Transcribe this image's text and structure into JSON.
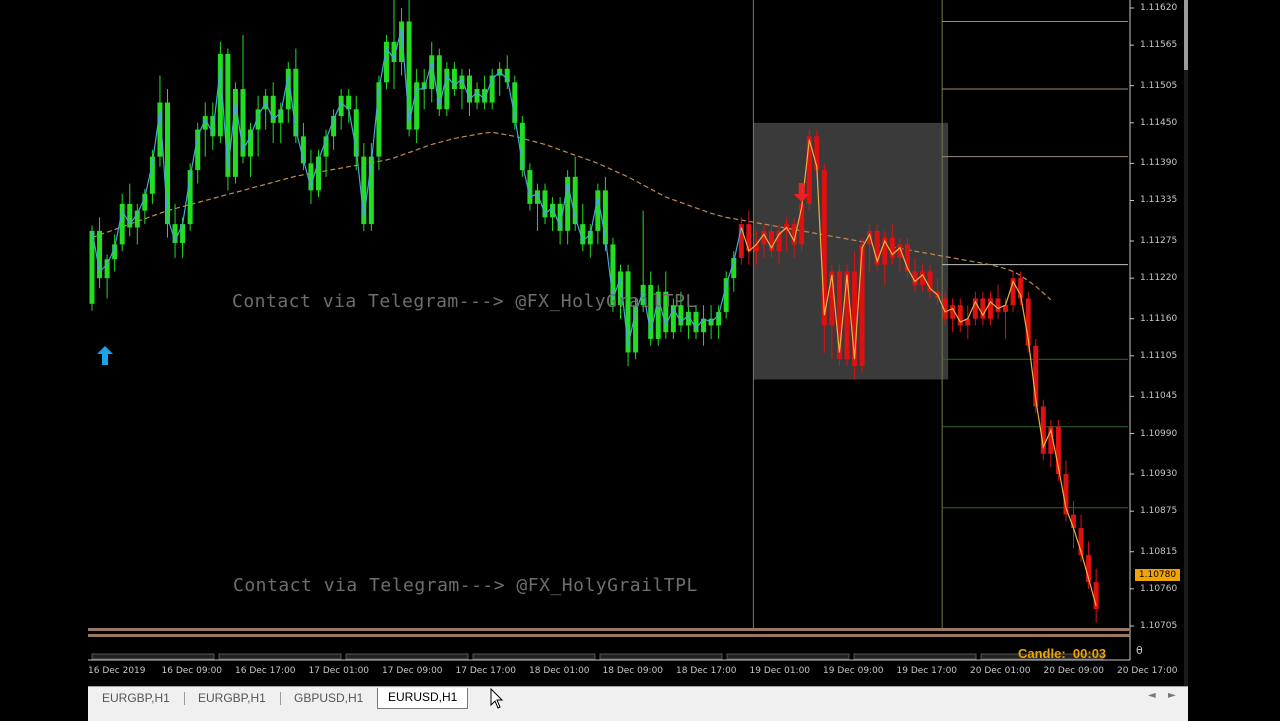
{
  "watermarks": [
    "Contact via Telegram---> @FX_HolyGrailTPL",
    "Contact via Telegram---> @FX_HolyGrailTPL"
  ],
  "price_axis": [
    "1.11620",
    "1.11565",
    "1.11505",
    "1.11450",
    "1.11390",
    "1.11335",
    "1.11275",
    "1.11220",
    "1.11160",
    "1.11105",
    "1.11045",
    "1.10990",
    "1.10930",
    "1.10875",
    "1.10815",
    "1.10760",
    "1.10705"
  ],
  "current_price": "1.10780",
  "time_axis": [
    "16 Dec 2019",
    "16 Dec 09:00",
    "16 Dec 17:00",
    "17 Dec 01:00",
    "17 Dec 09:00",
    "17 Dec 17:00",
    "18 Dec 01:00",
    "18 Dec 09:00",
    "18 Dec 17:00",
    "19 Dec 01:00",
    "19 Dec 09:00",
    "19 Dec 17:00",
    "20 Dec 01:00",
    "20 Dec 09:00",
    "20 Dec 17:00"
  ],
  "candle_timer": {
    "label": "Candle:",
    "value": "00:03"
  },
  "timer_marker": "θ",
  "tabs": [
    {
      "label": "EURGBP,H1",
      "active": false
    },
    {
      "label": "EURGBP,H1",
      "active": false
    },
    {
      "label": "GBPUSD,H1",
      "active": false
    },
    {
      "label": "EURUSD,H1",
      "active": true
    }
  ],
  "tab_scroll": {
    "left": "◄",
    "right": "►"
  },
  "colors": {
    "bull": "#22dd22",
    "bear": "#dd1111",
    "ma_fast_bull": "#4aa3df",
    "ma_fast_bear": "#f0b040",
    "ma_slow": "#c08a50",
    "buy_arrow": "#1aa3e8",
    "sell_arrow": "#ee2222",
    "zone": "#3a3a3a"
  },
  "icons": {
    "buy": "arrow-up-icon",
    "sell": "arrow-down-icon",
    "cursor": "mouse-cursor-icon"
  },
  "chart_data": {
    "type": "candlestick",
    "symbol": "EURUSD",
    "timeframe": "H1",
    "ylim": [
      1.10705,
      1.1162
    ],
    "x_range": [
      "16 Dec 2019 00:00",
      "20 Dec 2019 19:00"
    ],
    "candles": [
      [
        1.11182,
        1.11298,
        1.11172,
        1.1129
      ],
      [
        1.1129,
        1.1131,
        1.11205,
        1.1122
      ],
      [
        1.1122,
        1.11255,
        1.1119,
        1.11248
      ],
      [
        1.11248,
        1.11285,
        1.1123,
        1.1127
      ],
      [
        1.1127,
        1.11345,
        1.1126,
        1.1133
      ],
      [
        1.1133,
        1.1136,
        1.11282,
        1.11295
      ],
      [
        1.11295,
        1.1133,
        1.1127,
        1.1132
      ],
      [
        1.1132,
        1.11352,
        1.113,
        1.11345
      ],
      [
        1.11345,
        1.1141,
        1.1133,
        1.114
      ],
      [
        1.114,
        1.1152,
        1.11385,
        1.1148
      ],
      [
        1.1148,
        1.115,
        1.1128,
        1.113
      ],
      [
        1.113,
        1.1133,
        1.1125,
        1.11272
      ],
      [
        1.11272,
        1.1131,
        1.1125,
        1.113
      ],
      [
        1.113,
        1.1139,
        1.1129,
        1.1138
      ],
      [
        1.1138,
        1.1145,
        1.1136,
        1.1144
      ],
      [
        1.1144,
        1.1148,
        1.114,
        1.1146
      ],
      [
        1.1146,
        1.1148,
        1.1141,
        1.1143
      ],
      [
        1.1143,
        1.1157,
        1.1142,
        1.11552
      ],
      [
        1.11552,
        1.1156,
        1.1135,
        1.1137
      ],
      [
        1.1137,
        1.1151,
        1.1136,
        1.115
      ],
      [
        1.115,
        1.1158,
        1.1139,
        1.114
      ],
      [
        1.114,
        1.1145,
        1.1137,
        1.1144
      ],
      [
        1.1144,
        1.1149,
        1.114,
        1.1147
      ],
      [
        1.1147,
        1.115,
        1.1144,
        1.1149
      ],
      [
        1.1149,
        1.1151,
        1.1142,
        1.1145
      ],
      [
        1.1145,
        1.1148,
        1.1142,
        1.1147
      ],
      [
        1.1147,
        1.1154,
        1.1145,
        1.1153
      ],
      [
        1.1153,
        1.1156,
        1.1142,
        1.1143
      ],
      [
        1.1143,
        1.1145,
        1.1138,
        1.1139
      ],
      [
        1.1139,
        1.1141,
        1.1133,
        1.1135
      ],
      [
        1.1135,
        1.1141,
        1.1134,
        1.114
      ],
      [
        1.114,
        1.1144,
        1.1137,
        1.1143
      ],
      [
        1.1143,
        1.1147,
        1.1141,
        1.1146
      ],
      [
        1.1146,
        1.115,
        1.1144,
        1.1149
      ],
      [
        1.1149,
        1.115,
        1.1145,
        1.1147
      ],
      [
        1.1147,
        1.1149,
        1.1138,
        1.114
      ],
      [
        1.114,
        1.1142,
        1.1129,
        1.113
      ],
      [
        1.113,
        1.1142,
        1.1129,
        1.114
      ],
      [
        1.114,
        1.1152,
        1.1138,
        1.1151
      ],
      [
        1.1151,
        1.1158,
        1.115,
        1.1157
      ],
      [
        1.1157,
        1.1167,
        1.115,
        1.1154
      ],
      [
        1.1154,
        1.1162,
        1.1152,
        1.116
      ],
      [
        1.116,
        1.1164,
        1.1143,
        1.1144
      ],
      [
        1.1144,
        1.1153,
        1.1142,
        1.1151
      ],
      [
        1.1151,
        1.1153,
        1.1147,
        1.115
      ],
      [
        1.115,
        1.1157,
        1.1148,
        1.1155
      ],
      [
        1.1155,
        1.1156,
        1.1146,
        1.1147
      ],
      [
        1.1147,
        1.1154,
        1.1146,
        1.1153
      ],
      [
        1.1153,
        1.1154,
        1.1149,
        1.115
      ],
      [
        1.115,
        1.1153,
        1.1147,
        1.1152
      ],
      [
        1.1152,
        1.1153,
        1.1146,
        1.1148
      ],
      [
        1.1148,
        1.1151,
        1.1147,
        1.115
      ],
      [
        1.115,
        1.1152,
        1.1147,
        1.1148
      ],
      [
        1.1148,
        1.1153,
        1.1147,
        1.1152
      ],
      [
        1.1152,
        1.1154,
        1.1149,
        1.1153
      ],
      [
        1.1153,
        1.1155,
        1.115,
        1.1151
      ],
      [
        1.1151,
        1.1152,
        1.1144,
        1.1145
      ],
      [
        1.1145,
        1.1146,
        1.1137,
        1.1138
      ],
      [
        1.1138,
        1.1139,
        1.1132,
        1.1133
      ],
      [
        1.1133,
        1.1136,
        1.1129,
        1.1135
      ],
      [
        1.1135,
        1.1136,
        1.113,
        1.1131
      ],
      [
        1.1131,
        1.1134,
        1.1129,
        1.1133
      ],
      [
        1.1133,
        1.1134,
        1.1127,
        1.1129
      ],
      [
        1.1129,
        1.1138,
        1.1127,
        1.1137
      ],
      [
        1.1137,
        1.114,
        1.1129,
        1.113
      ],
      [
        1.113,
        1.1133,
        1.1126,
        1.1127
      ],
      [
        1.1127,
        1.113,
        1.1125,
        1.1129
      ],
      [
        1.1129,
        1.1136,
        1.1127,
        1.1135
      ],
      [
        1.1135,
        1.1137,
        1.1126,
        1.1127
      ],
      [
        1.1127,
        1.1128,
        1.1117,
        1.1118
      ],
      [
        1.1118,
        1.1124,
        1.1116,
        1.1123
      ],
      [
        1.1123,
        1.1124,
        1.1109,
        1.1111
      ],
      [
        1.1111,
        1.1119,
        1.111,
        1.1118
      ],
      [
        1.1118,
        1.1132,
        1.1117,
        1.1121
      ],
      [
        1.1121,
        1.1123,
        1.1112,
        1.1113
      ],
      [
        1.1113,
        1.1121,
        1.1112,
        1.112
      ],
      [
        1.112,
        1.1123,
        1.1113,
        1.1114
      ],
      [
        1.1114,
        1.1119,
        1.1113,
        1.1118
      ],
      [
        1.1118,
        1.112,
        1.1114,
        1.1115
      ],
      [
        1.1115,
        1.1119,
        1.1113,
        1.1117
      ],
      [
        1.1117,
        1.1118,
        1.1113,
        1.1114
      ],
      [
        1.1114,
        1.1118,
        1.1112,
        1.1116
      ],
      [
        1.1116,
        1.1118,
        1.1113,
        1.1115
      ],
      [
        1.1115,
        1.1118,
        1.1113,
        1.1117
      ],
      [
        1.1117,
        1.1123,
        1.1116,
        1.1122
      ],
      [
        1.1122,
        1.1126,
        1.112,
        1.1125
      ],
      [
        1.1125,
        1.1131,
        1.1124,
        1.113
      ],
      [
        1.113,
        1.1132,
        1.1124,
        1.1126
      ],
      [
        1.1126,
        1.1129,
        1.1124,
        1.1127
      ],
      [
        1.1127,
        1.113,
        1.1125,
        1.1129
      ],
      [
        1.1129,
        1.113,
        1.1125,
        1.1126
      ],
      [
        1.1126,
        1.113,
        1.1124,
        1.1129
      ],
      [
        1.1129,
        1.1131,
        1.1126,
        1.113
      ],
      [
        1.113,
        1.1131,
        1.1125,
        1.1127
      ],
      [
        1.1127,
        1.1134,
        1.1126,
        1.1133
      ],
      [
        1.1133,
        1.1144,
        1.1132,
        1.1143
      ],
      [
        1.1143,
        1.1144,
        1.1137,
        1.1138
      ],
      [
        1.1138,
        1.1139,
        1.1111,
        1.1115
      ],
      [
        1.1115,
        1.1124,
        1.111,
        1.1123
      ],
      [
        1.1123,
        1.1124,
        1.1109,
        1.111
      ],
      [
        1.111,
        1.1124,
        1.1109,
        1.1123
      ],
      [
        1.1123,
        1.1126,
        1.1107,
        1.1109
      ],
      [
        1.1109,
        1.1128,
        1.1108,
        1.1127
      ],
      [
        1.1127,
        1.113,
        1.1123,
        1.1129
      ],
      [
        1.1129,
        1.113,
        1.1123,
        1.1124
      ],
      [
        1.1124,
        1.1129,
        1.1121,
        1.1128
      ],
      [
        1.1128,
        1.113,
        1.1124,
        1.1125
      ],
      [
        1.1125,
        1.1128,
        1.1123,
        1.1127
      ],
      [
        1.1127,
        1.1128,
        1.1122,
        1.1123
      ],
      [
        1.1123,
        1.1125,
        1.112,
        1.1121
      ],
      [
        1.1121,
        1.1124,
        1.112,
        1.1123
      ],
      [
        1.1123,
        1.1124,
        1.1119,
        1.112
      ],
      [
        1.112,
        1.1122,
        1.1118,
        1.1119
      ],
      [
        1.1119,
        1.112,
        1.1115,
        1.1116
      ],
      [
        1.1116,
        1.1119,
        1.1114,
        1.1118
      ],
      [
        1.1118,
        1.1119,
        1.1114,
        1.1115
      ],
      [
        1.1115,
        1.1118,
        1.1113,
        1.1116
      ],
      [
        1.1116,
        1.112,
        1.1115,
        1.1119
      ],
      [
        1.1119,
        1.112,
        1.1115,
        1.1116
      ],
      [
        1.1116,
        1.112,
        1.1115,
        1.1119
      ],
      [
        1.1119,
        1.1121,
        1.1116,
        1.1117
      ],
      [
        1.1117,
        1.1119,
        1.1113,
        1.1118
      ],
      [
        1.1118,
        1.1123,
        1.1117,
        1.1122
      ],
      [
        1.1122,
        1.1123,
        1.1118,
        1.1119
      ],
      [
        1.1119,
        1.112,
        1.1111,
        1.1112
      ],
      [
        1.1112,
        1.1113,
        1.1102,
        1.1103
      ],
      [
        1.1103,
        1.1104,
        1.1095,
        1.1096
      ],
      [
        1.1096,
        1.1101,
        1.1094,
        1.11
      ],
      [
        1.11,
        1.1101,
        1.1092,
        1.1093
      ],
      [
        1.1093,
        1.1095,
        1.1086,
        1.1087
      ],
      [
        1.1087,
        1.1089,
        1.1082,
        1.1085
      ],
      [
        1.1085,
        1.1087,
        1.108,
        1.1081
      ],
      [
        1.1081,
        1.1083,
        1.1076,
        1.1077
      ],
      [
        1.1077,
        1.1079,
        1.1071,
        1.1073
      ]
    ],
    "ma_fast": [
      1.1129,
      1.1123,
      1.1124,
      1.11265,
      1.1132,
      1.113,
      1.11315,
      1.1134,
      1.1139,
      1.1147,
      1.1131,
      1.11275,
      1.113,
      1.1137,
      1.1143,
      1.11455,
      1.11435,
      1.1153,
      1.1138,
      1.1148,
      1.1141,
      1.1143,
      1.1146,
      1.1148,
      1.11455,
      1.11465,
      1.1152,
      1.1144,
      1.11395,
      1.11355,
      1.11395,
      1.11425,
      1.11455,
      1.1148,
      1.1147,
      1.1141,
      1.1131,
      1.1139,
      1.115,
      1.1156,
      1.11545,
      1.1159,
      1.1145,
      1.115,
      1.115,
      1.1154,
      1.11475,
      1.1152,
      1.11505,
      1.11515,
      1.11485,
      1.11495,
      1.11485,
      1.11515,
      1.11525,
      1.11515,
      1.1146,
      1.1139,
      1.1134,
      1.11345,
      1.11315,
      1.11325,
      1.11295,
      1.1136,
      1.1131,
      1.11275,
      1.11285,
      1.1134,
      1.1128,
      1.1119,
      1.1122,
      1.1112,
      1.1117,
      1.112,
      1.1114,
      1.1119,
      1.1115,
      1.11175,
      1.11155,
      1.11165,
      1.11145,
      1.1116,
      1.11155,
      1.11165,
      1.1121,
      1.11245,
      1.11295,
      1.1126,
      1.1127,
      1.11285,
      1.11265,
      1.11285,
      1.11295,
      1.11275,
      1.11325,
      1.11425,
      1.11385,
      1.11165,
      1.11225,
      1.1111,
      1.11225,
      1.111,
      1.11265,
      1.11285,
      1.11245,
      1.11275,
      1.11255,
      1.11265,
      1.11235,
      1.11215,
      1.11225,
      1.11205,
      1.11195,
      1.1117,
      1.11175,
      1.11155,
      1.1116,
      1.11185,
      1.11165,
      1.11185,
      1.11175,
      1.1118,
      1.11215,
      1.11195,
      1.1113,
      1.1104,
      1.1097,
      1.10995,
      1.1094,
      1.1088,
      1.1085,
      1.10815,
      1.10775,
      1.10735
    ],
    "ma_slow": [
      1.1128,
      1.11284,
      1.11288,
      1.11292,
      1.11296,
      1.113,
      1.11304,
      1.11308,
      1.11312,
      1.11316,
      1.1132,
      1.11323,
      1.11326,
      1.11329,
      1.11332,
      1.11335,
      1.11338,
      1.11341,
      1.11344,
      1.11347,
      1.1135,
      1.11353,
      1.11356,
      1.11359,
      1.11362,
      1.11365,
      1.11368,
      1.11371,
      1.11373,
      1.11375,
      1.11377,
      1.11379,
      1.11381,
      1.11383,
      1.11385,
      1.11387,
      1.11389,
      1.11391,
      1.11393,
      1.11395,
      1.11398,
      1.11402,
      1.11406,
      1.1141,
      1.11414,
      1.11418,
      1.11421,
      1.11424,
      1.11427,
      1.11429,
      1.11431,
      1.11433,
      1.11435,
      1.11436,
      1.11434,
      1.11432,
      1.1143,
      1.11427,
      1.11424,
      1.11421,
      1.11418,
      1.11414,
      1.1141,
      1.11406,
      1.11402,
      1.11398,
      1.11394,
      1.1139,
      1.11385,
      1.1138,
      1.11375,
      1.1137,
      1.11364,
      1.11358,
      1.11352,
      1.11346,
      1.1134,
      1.11336,
      1.11332,
      1.11328,
      1.11324,
      1.1132,
      1.11316,
      1.11313,
      1.1131,
      1.11308,
      1.11306,
      1.11304,
      1.11302,
      1.113,
      1.11298,
      1.11296,
      1.11294,
      1.11292,
      1.1129,
      1.11288,
      1.11286,
      1.11284,
      1.11282,
      1.1128,
      1.11278,
      1.11276,
      1.11274,
      1.11272,
      1.1127,
      1.11268,
      1.11266,
      1.11264,
      1.11262,
      1.1126,
      1.11258,
      1.11256,
      1.11254,
      1.11252,
      1.1125,
      1.11248,
      1.11246,
      1.11244,
      1.11242,
      1.1124,
      1.11237,
      1.11234,
      1.1123,
      1.11224,
      1.11216,
      1.11208,
      1.11198,
      1.11188
    ],
    "zones": [
      {
        "from": 88,
        "to": 113,
        "top": 1.1145,
        "bottom": 1.1107
      }
    ],
    "vertical_lines": [
      88,
      113
    ],
    "horizontal_levels": [
      1.116,
      1.115,
      1.114,
      1.1124,
      1.111,
      1.11,
      1.1088
    ],
    "signals": [
      {
        "type": "buy",
        "index": 0,
        "price": 1.1112
      },
      {
        "type": "sell",
        "index": 94,
        "price": 1.1136
      }
    ]
  }
}
